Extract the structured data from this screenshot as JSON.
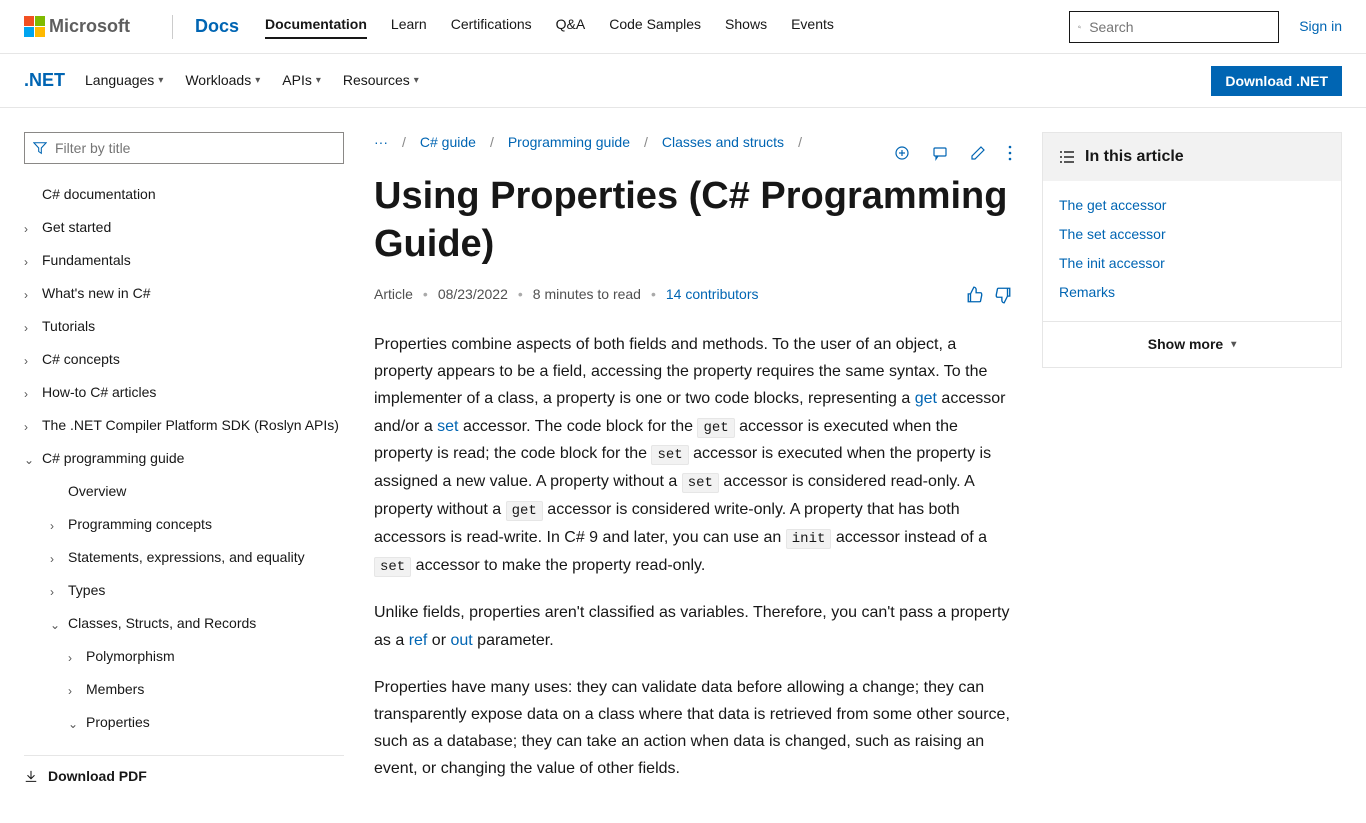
{
  "header": {
    "brand": "Microsoft",
    "docs": "Docs",
    "nav": {
      "documentation": "Documentation",
      "learn": "Learn",
      "certifications": "Certifications",
      "qa": "Q&A",
      "samples": "Code Samples",
      "shows": "Shows",
      "events": "Events"
    },
    "search_placeholder": "Search",
    "sign_in": "Sign in"
  },
  "subheader": {
    "product": ".NET",
    "languages": "Languages",
    "workloads": "Workloads",
    "apis": "APIs",
    "resources": "Resources",
    "download": "Download .NET"
  },
  "sidebar": {
    "filter_placeholder": "Filter by title",
    "items": [
      {
        "label": "C# documentation",
        "expandable": false
      },
      {
        "label": "Get started",
        "expandable": true
      },
      {
        "label": "Fundamentals",
        "expandable": true
      },
      {
        "label": "What's new in C#",
        "expandable": true
      },
      {
        "label": "Tutorials",
        "expandable": true
      },
      {
        "label": "C# concepts",
        "expandable": true
      },
      {
        "label": "How-to C# articles",
        "expandable": true
      },
      {
        "label": "The .NET Compiler Platform SDK (Roslyn APIs)",
        "expandable": true
      },
      {
        "label": "C# programming guide",
        "expandable": true,
        "open": true
      }
    ],
    "sub1": [
      {
        "label": "Overview",
        "expandable": false
      },
      {
        "label": "Programming concepts",
        "expandable": true
      },
      {
        "label": "Statements, expressions, and equality",
        "expandable": true
      },
      {
        "label": "Types",
        "expandable": true
      },
      {
        "label": "Classes, Structs, and Records",
        "expandable": true,
        "open": true
      }
    ],
    "sub2": [
      {
        "label": "Polymorphism",
        "expandable": true
      },
      {
        "label": "Members",
        "expandable": true
      },
      {
        "label": "Properties",
        "expandable": true,
        "open": true
      }
    ],
    "download_pdf": "Download PDF"
  },
  "breadcrumb": {
    "ellipsis": "···",
    "c1": "C# guide",
    "c2": "Programming guide",
    "c3": "Classes and structs"
  },
  "article": {
    "title": "Using Properties (C# Programming Guide)",
    "kind": "Article",
    "date": "08/23/2022",
    "readtime": "8 minutes to read",
    "contributors": "14 contributors",
    "p1a": "Properties combine aspects of both fields and methods. To the user of an object, a property appears to be a field, accessing the property requires the same syntax. To the implementer of a class, a property is one or two code blocks, representing a ",
    "p1_get_link": "get",
    "p1b": " accessor and/or a ",
    "p1_set_link": "set",
    "p1c": " accessor. The code block for the ",
    "p1_code_get1": "get",
    "p1d": " accessor is executed when the property is read; the code block for the ",
    "p1_code_set1": "set",
    "p1e": " accessor is executed when the property is assigned a new value. A property without a ",
    "p1_code_set2": "set",
    "p1f": " accessor is considered read-only. A property without a ",
    "p1_code_get2": "get",
    "p1g": " accessor is considered write-only. A property that has both accessors is read-write. In C# 9 and later, you can use an ",
    "p1_code_init": "init",
    "p1h": " accessor instead of a ",
    "p1_code_set3": "set",
    "p1i": " accessor to make the property read-only.",
    "p2a": "Unlike fields, properties aren't classified as variables. Therefore, you can't pass a property as a ",
    "p2_ref": "ref",
    "p2b": " or ",
    "p2_out": "out",
    "p2c": " parameter.",
    "p3": "Properties have many uses: they can validate data before allowing a change; they can transparently expose data on a class where that data is retrieved from some other source, such as a database; they can take an action when data is changed, such as raising an event, or changing the value of other fields."
  },
  "toc": {
    "title": "In this article",
    "items": {
      "i0": "The get accessor",
      "i1": "The set accessor",
      "i2": "The init accessor",
      "i3": "Remarks"
    },
    "show_more": "Show more"
  }
}
